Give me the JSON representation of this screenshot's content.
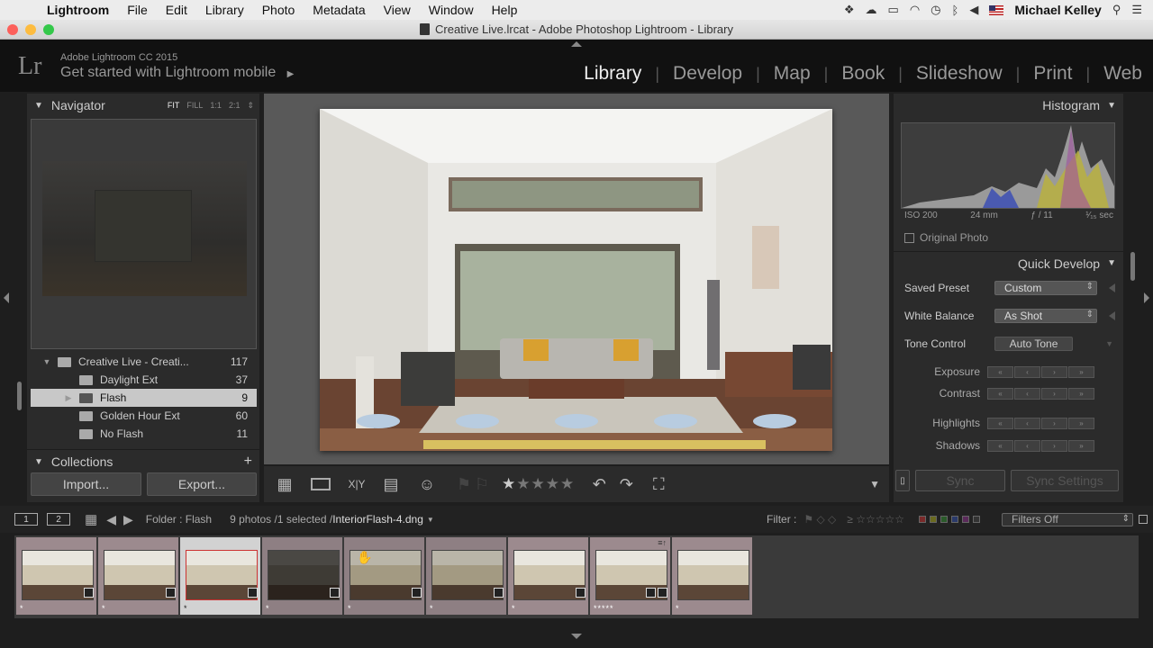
{
  "menubar": {
    "app": "Lightroom",
    "items": [
      "File",
      "Edit",
      "Library",
      "Photo",
      "Metadata",
      "View",
      "Window",
      "Help"
    ],
    "user": "Michael Kelley"
  },
  "window": {
    "title": "Creative Live.lrcat - Adobe Photoshop Lightroom - Library"
  },
  "identity": {
    "logo": "Lr",
    "product": "Adobe Lightroom CC 2015",
    "mobile": "Get started with Lightroom mobile",
    "mobile_arrow": "▶"
  },
  "modules": [
    "Library",
    "Develop",
    "Map",
    "Book",
    "Slideshow",
    "Print",
    "Web"
  ],
  "navigator": {
    "title": "Navigator",
    "options": [
      "FIT",
      "FILL",
      "1:1",
      "2:1"
    ]
  },
  "folders": [
    {
      "name": "Creative Live - Creati...",
      "count": "117",
      "level": 0,
      "expanded": true
    },
    {
      "name": "Daylight Ext",
      "count": "37",
      "level": 1
    },
    {
      "name": "Flash",
      "count": "9",
      "level": 1,
      "selected": true
    },
    {
      "name": "Golden Hour Ext",
      "count": "60",
      "level": 1
    },
    {
      "name": "No Flash",
      "count": "11",
      "level": 1
    }
  ],
  "collections": {
    "title": "Collections",
    "plus": "+"
  },
  "left_buttons": {
    "import": "Import...",
    "export": "Export..."
  },
  "histogram": {
    "title": "Histogram",
    "iso": "ISO 200",
    "focal": "24 mm",
    "aperture": "ƒ / 11",
    "shutter": "¹⁄₁₅ sec",
    "original_photo": "Original Photo"
  },
  "quick_develop": {
    "title": "Quick Develop",
    "saved_preset_label": "Saved Preset",
    "saved_preset_value": "Custom",
    "white_balance_label": "White Balance",
    "white_balance_value": "As Shot",
    "tone_control_label": "Tone Control",
    "auto_tone": "Auto Tone",
    "exposure": "Exposure",
    "contrast": "Contrast",
    "highlights": "Highlights",
    "shadows": "Shadows"
  },
  "sync": {
    "sync": "Sync",
    "sync_settings": "Sync Settings"
  },
  "filmbar": {
    "page1": "1",
    "page2": "2",
    "source": "Folder : Flash",
    "count_text": "9 photos /1 selected /",
    "filename": "InteriorFlash-4.dng",
    "filter_label": "Filter :",
    "filters_off": "Filters Off"
  },
  "filmstrip": [
    {
      "stars": "*",
      "tone": "light"
    },
    {
      "stars": "*",
      "tone": "light"
    },
    {
      "stars": "*",
      "tone": "light",
      "selected": true
    },
    {
      "stars": "*",
      "tone": "dark"
    },
    {
      "stars": "*",
      "tone": "mid"
    },
    {
      "stars": "*",
      "tone": "mid"
    },
    {
      "stars": "*",
      "tone": "light"
    },
    {
      "stars": "*****",
      "tone": "light"
    },
    {
      "stars": "*",
      "tone": "light"
    }
  ],
  "colors": {
    "panel": "#2b2b2b",
    "center_bg": "#595959",
    "film_cell": "#9c8a8e",
    "selected_row": "#c8c8c8"
  }
}
